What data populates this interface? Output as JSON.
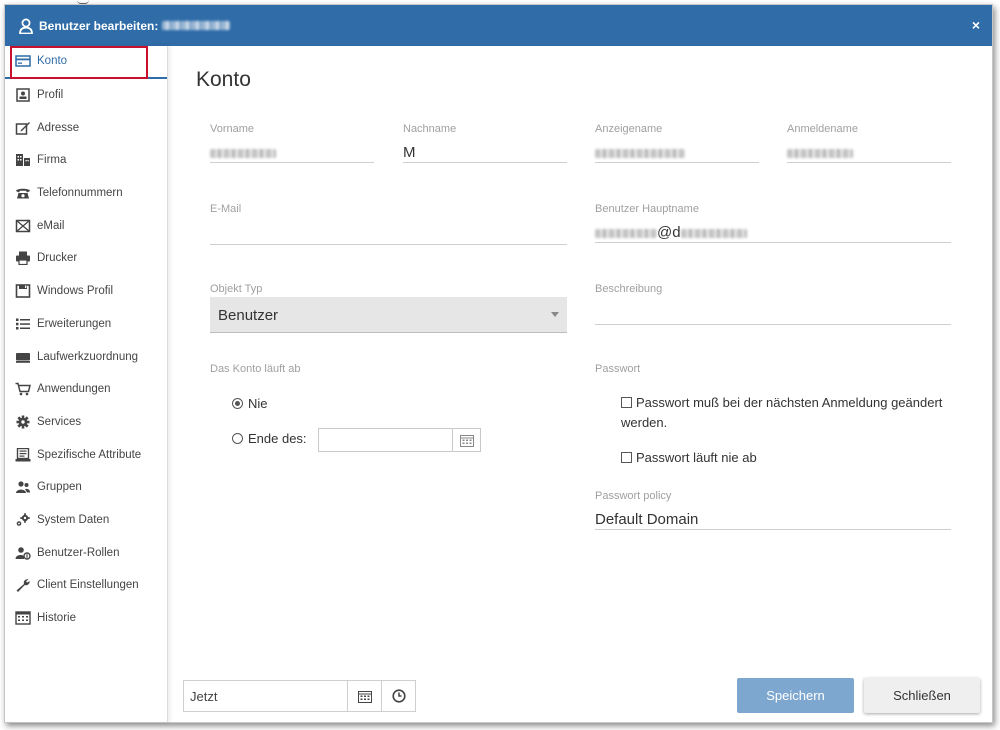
{
  "window": {
    "title": "Benutzer bearbeiten:",
    "close_label": "×"
  },
  "sidebar": {
    "items": [
      {
        "label": "Konto",
        "icon": "card-icon",
        "active": true
      },
      {
        "label": "Profil",
        "icon": "profile-icon"
      },
      {
        "label": "Adresse",
        "icon": "edit-icon"
      },
      {
        "label": "Firma",
        "icon": "building-icon"
      },
      {
        "label": "Telefonnummern",
        "icon": "phone-icon"
      },
      {
        "label": "eMail",
        "icon": "envelope-icon"
      },
      {
        "label": "Drucker",
        "icon": "printer-icon"
      },
      {
        "label": "Windows Profil",
        "icon": "floppy-icon"
      },
      {
        "label": "Erweiterungen",
        "icon": "list-icon"
      },
      {
        "label": "Laufwerkzuordnung",
        "icon": "drive-icon"
      },
      {
        "label": "Anwendungen",
        "icon": "cart-icon"
      },
      {
        "label": "Services",
        "icon": "gear-icon"
      },
      {
        "label": "Spezifische Attribute",
        "icon": "attributes-icon"
      },
      {
        "label": "Gruppen",
        "icon": "group-icon"
      },
      {
        "label": "System Daten",
        "icon": "gears-icon"
      },
      {
        "label": "Benutzer-Rollen",
        "icon": "user-role-icon"
      },
      {
        "label": "Client Einstellungen",
        "icon": "wrench-icon"
      },
      {
        "label": "Historie",
        "icon": "calendar-grid-icon"
      }
    ]
  },
  "main": {
    "title": "Konto",
    "fields": {
      "vorname": {
        "label": "Vorname",
        "value": ""
      },
      "nachname": {
        "label": "Nachname",
        "value": "M"
      },
      "anzeigename": {
        "label": "Anzeigename",
        "value": ""
      },
      "anmeldename": {
        "label": "Anmeldename",
        "value": ""
      },
      "email": {
        "label": "E-Mail",
        "value": ""
      },
      "hauptname": {
        "label": "Benutzer Hauptname",
        "value_visible": "@d"
      },
      "objekt_typ": {
        "label": "Objekt Typ",
        "value": "Benutzer"
      },
      "beschreibung": {
        "label": "Beschreibung",
        "value": ""
      },
      "policy": {
        "label": "Passwort policy",
        "value": "Default Domain"
      }
    },
    "expiry": {
      "label": "Das Konto läuft ab",
      "option_never": "Nie",
      "option_end": "Ende des:",
      "selected": "Nie",
      "end_value": ""
    },
    "password": {
      "label": "Passwort",
      "change_at_next_login": "Passwort muß bei der nächsten Anmeldung geändert werden.",
      "never_expires": "Passwort läuft nie ab"
    }
  },
  "footer": {
    "date_value": "Jetzt",
    "save_label": "Speichern",
    "close_label": "Schließen"
  },
  "colors": {
    "header": "#2f6ca8",
    "accent": "#2f6ca8",
    "save_button": "#7ea7cf",
    "highlight_outline": "#c8102e"
  }
}
